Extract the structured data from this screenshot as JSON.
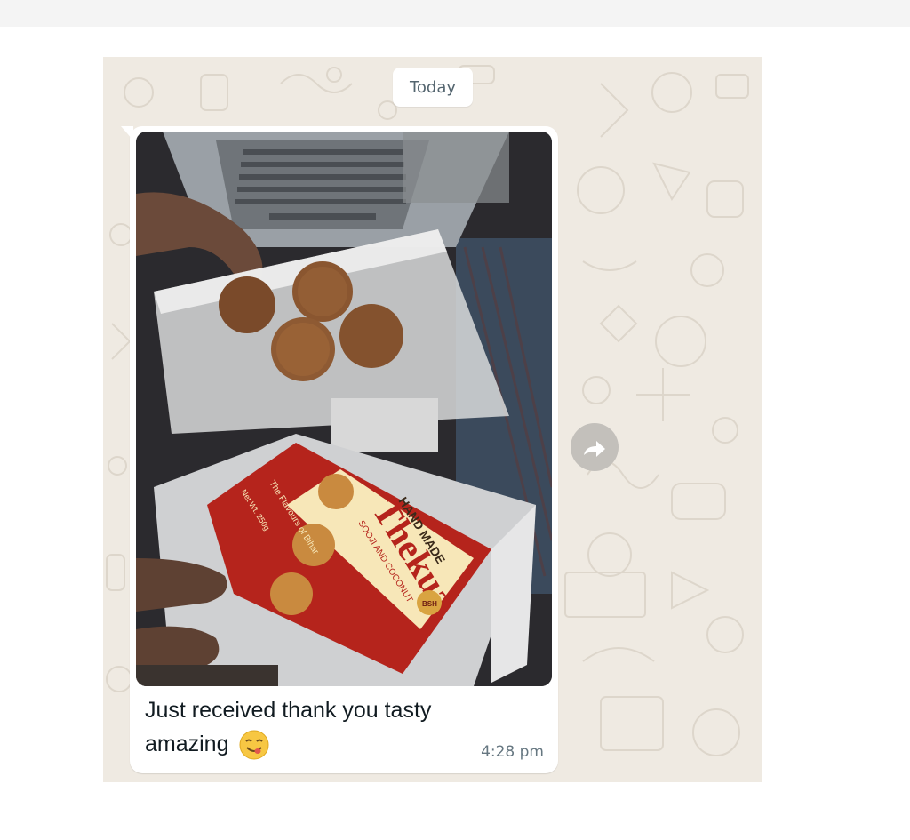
{
  "chat": {
    "date_divider": "Today",
    "message": {
      "caption": "Just received thank you tasty amazing",
      "caption_line1": "Just received thank you tasty",
      "caption_line2": "amazing",
      "emoji": "face-savoring-food",
      "time": "4:28 pm",
      "photo": {
        "package_title": "Thekua",
        "package_top": "HAND MADE",
        "package_subtitle": "SOOJI AND COCONUT",
        "package_side": "The Flavours of Bihar",
        "package_net": "Net Wt. 250g",
        "brand_badge": "BSH"
      }
    },
    "forward_icon": "forward-arrow-icon"
  },
  "colors": {
    "wallpaper": "#efeae2",
    "bubble": "#ffffff",
    "time_text": "#667781",
    "package_red": "#b5241c",
    "package_cream": "#f7e7b8"
  }
}
